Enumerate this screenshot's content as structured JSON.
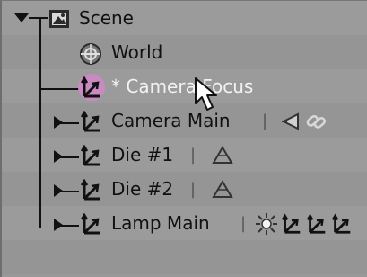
{
  "outliner": {
    "rows": [
      {
        "label": "Scene",
        "type": "scene",
        "expanded": true
      },
      {
        "label": "World",
        "type": "world"
      },
      {
        "label": "* Camera Focus",
        "type": "object",
        "selected": true
      },
      {
        "label": "Camera Main",
        "type": "object",
        "expanded": false,
        "extras": [
          "camera-icon",
          "constraint-icon"
        ]
      },
      {
        "label": "Die #1",
        "type": "object",
        "expanded": false,
        "extras": [
          "mesh-icon"
        ]
      },
      {
        "label": "Die #2",
        "type": "object",
        "expanded": false,
        "extras": [
          "mesh-icon"
        ]
      },
      {
        "label": "Lamp Main",
        "type": "object",
        "expanded": false,
        "extras": [
          "lamp-icon",
          "child-object-icon",
          "child-object-icon",
          "child-object-icon"
        ]
      }
    ],
    "separator": "|"
  },
  "colors": {
    "selection": "#c98ac3",
    "background": "#9a9a9a"
  }
}
